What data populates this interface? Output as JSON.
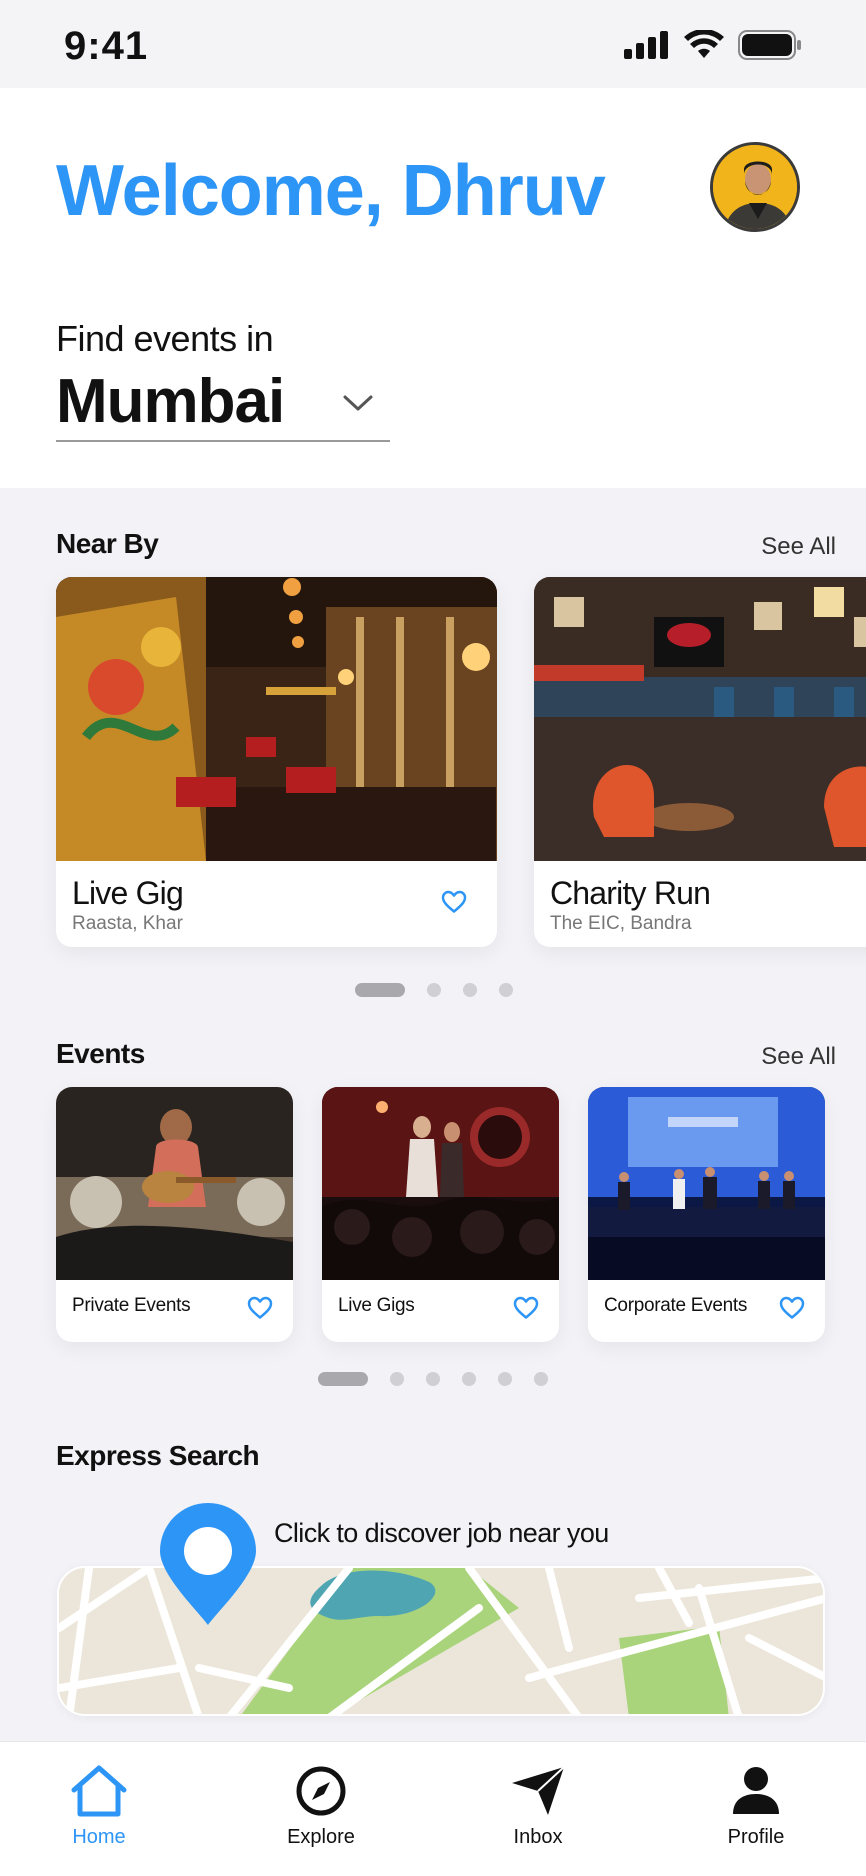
{
  "status_bar": {
    "time": "9:41"
  },
  "header": {
    "welcome": "Welcome, Dhruv",
    "find_label": "Find events in",
    "city": "Mumbai"
  },
  "nearby": {
    "title": "Near By",
    "see_all": "See All",
    "cards": [
      {
        "title": "Live Gig",
        "subtitle": "Raasta, Khar"
      },
      {
        "title": "Charity Run",
        "subtitle": "The EIC, Bandra"
      }
    ],
    "pagination": {
      "total": 4,
      "active": 1
    }
  },
  "events": {
    "title": "Events",
    "see_all": "See All",
    "cards": [
      {
        "label": "Private Events"
      },
      {
        "label": "Live Gigs"
      },
      {
        "label": "Corporate Events"
      }
    ],
    "pagination": {
      "total": 6,
      "active": 1
    }
  },
  "express": {
    "title": "Express Search",
    "cta": "Click to discover job near you"
  },
  "tabbar": {
    "items": [
      {
        "label": "Home",
        "icon": "home-icon",
        "active": true
      },
      {
        "label": "Explore",
        "icon": "compass-icon",
        "active": false
      },
      {
        "label": "Inbox",
        "icon": "send-icon",
        "active": false
      },
      {
        "label": "Profile",
        "icon": "person-icon",
        "active": false
      }
    ]
  },
  "colors": {
    "accent": "#2d95f5",
    "background": "#f2f2f7",
    "card": "#ffffff",
    "map_land": "#ece6da",
    "map_park": "#a9d47b",
    "map_water": "#4fa6b2"
  }
}
